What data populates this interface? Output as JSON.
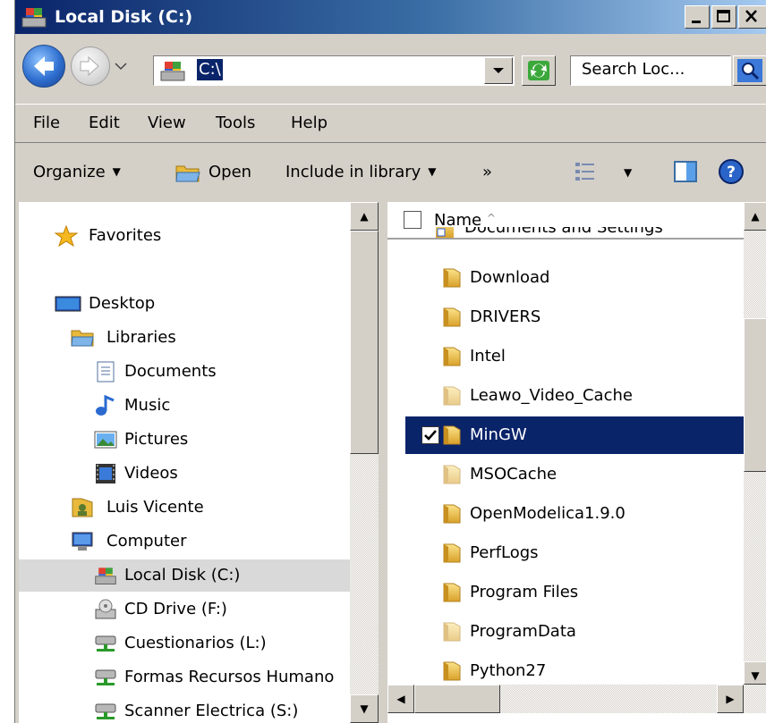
{
  "window": {
    "title": "Local Disk (C:)"
  },
  "address": {
    "path": "C:\\",
    "search_placeholder": "Search Loc..."
  },
  "menu": [
    "File",
    "Edit",
    "View",
    "Tools",
    "Help"
  ],
  "commands": {
    "organize": "Organize",
    "open": "Open",
    "include": "Include in library",
    "more": "»"
  },
  "nav": {
    "favorites": "Favorites",
    "desktop": "Desktop",
    "libraries": "Libraries",
    "documents": "Documents",
    "music": "Music",
    "pictures": "Pictures",
    "videos": "Videos",
    "user": "Luis  Vicente",
    "computer": "Computer",
    "local_disk": "Local Disk (C:)",
    "cd_drive": "CD Drive (F:)",
    "cuestionarios": "Cuestionarios (L:)",
    "formas": "Formas Recursos Humano",
    "scanner": "Scanner Electrica (S:)"
  },
  "files": {
    "header": "Name",
    "sort_indicator": "^",
    "partial": "Documents and Settings",
    "items": [
      "Download",
      "DRIVERS",
      "Intel",
      "Leawo_Video_Cache",
      "MinGW",
      "MSOCache",
      "OpenModelica1.9.0",
      "PerfLogs",
      "Program Files",
      "ProgramData",
      "Python27"
    ],
    "selected": "MinGW"
  },
  "colors": {
    "selection": "#0a246a",
    "folder": "#e8b93a",
    "titlebar": "#0a246a"
  }
}
